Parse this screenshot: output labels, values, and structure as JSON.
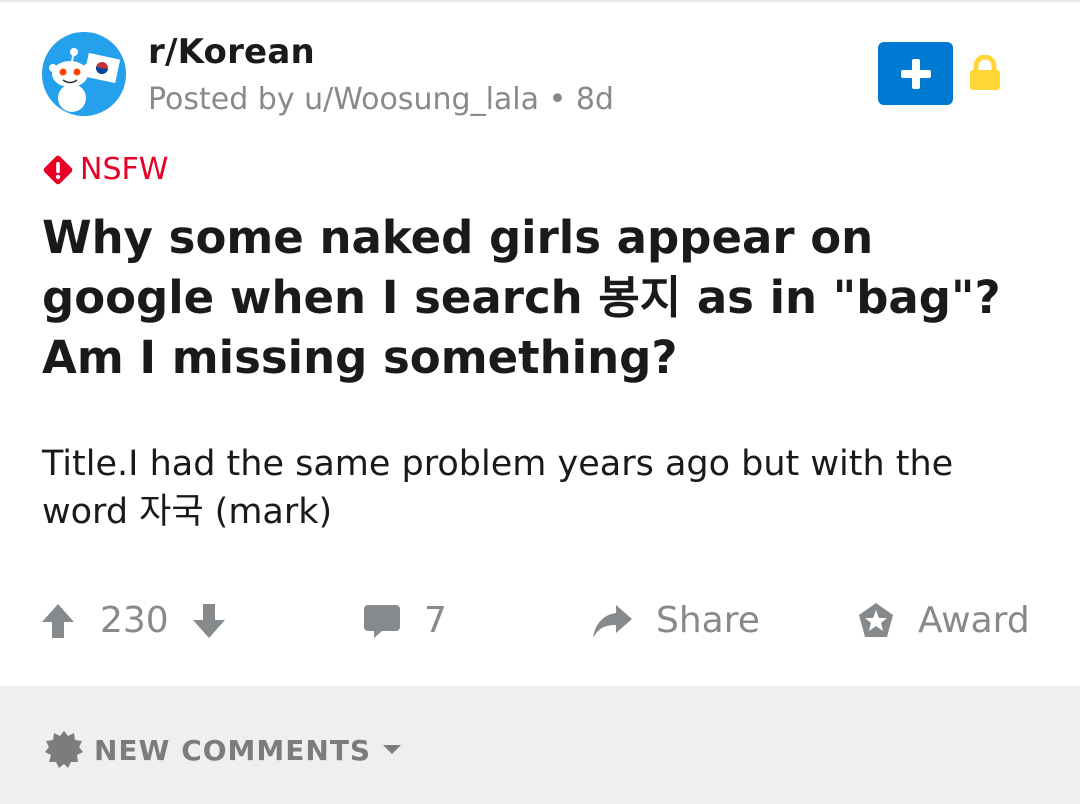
{
  "header": {
    "subreddit": "r/Korean",
    "posted_by": "Posted by u/Woosung_lala",
    "separator": "•",
    "age": "8d",
    "join_icon": "plus-icon",
    "lock_icon": "lock-icon"
  },
  "post": {
    "nsfw_label": "NSFW",
    "title": "Why some naked girls appear on google when I search 봉지 as in \"bag\"? Am I missing something?",
    "body": "Title.I had the same problem years ago but with the word 자국 (mark)"
  },
  "actions": {
    "score": "230",
    "comments": "7",
    "share": "Share",
    "award": "Award"
  },
  "comments_bar": {
    "sort_label": "NEW COMMENTS"
  },
  "colors": {
    "accent_blue": "#0079d3",
    "nsfw_red": "#ea0027",
    "lock_yellow": "#ffd635",
    "meta_gray": "#878a8c",
    "bar_bg": "#edeff1"
  }
}
